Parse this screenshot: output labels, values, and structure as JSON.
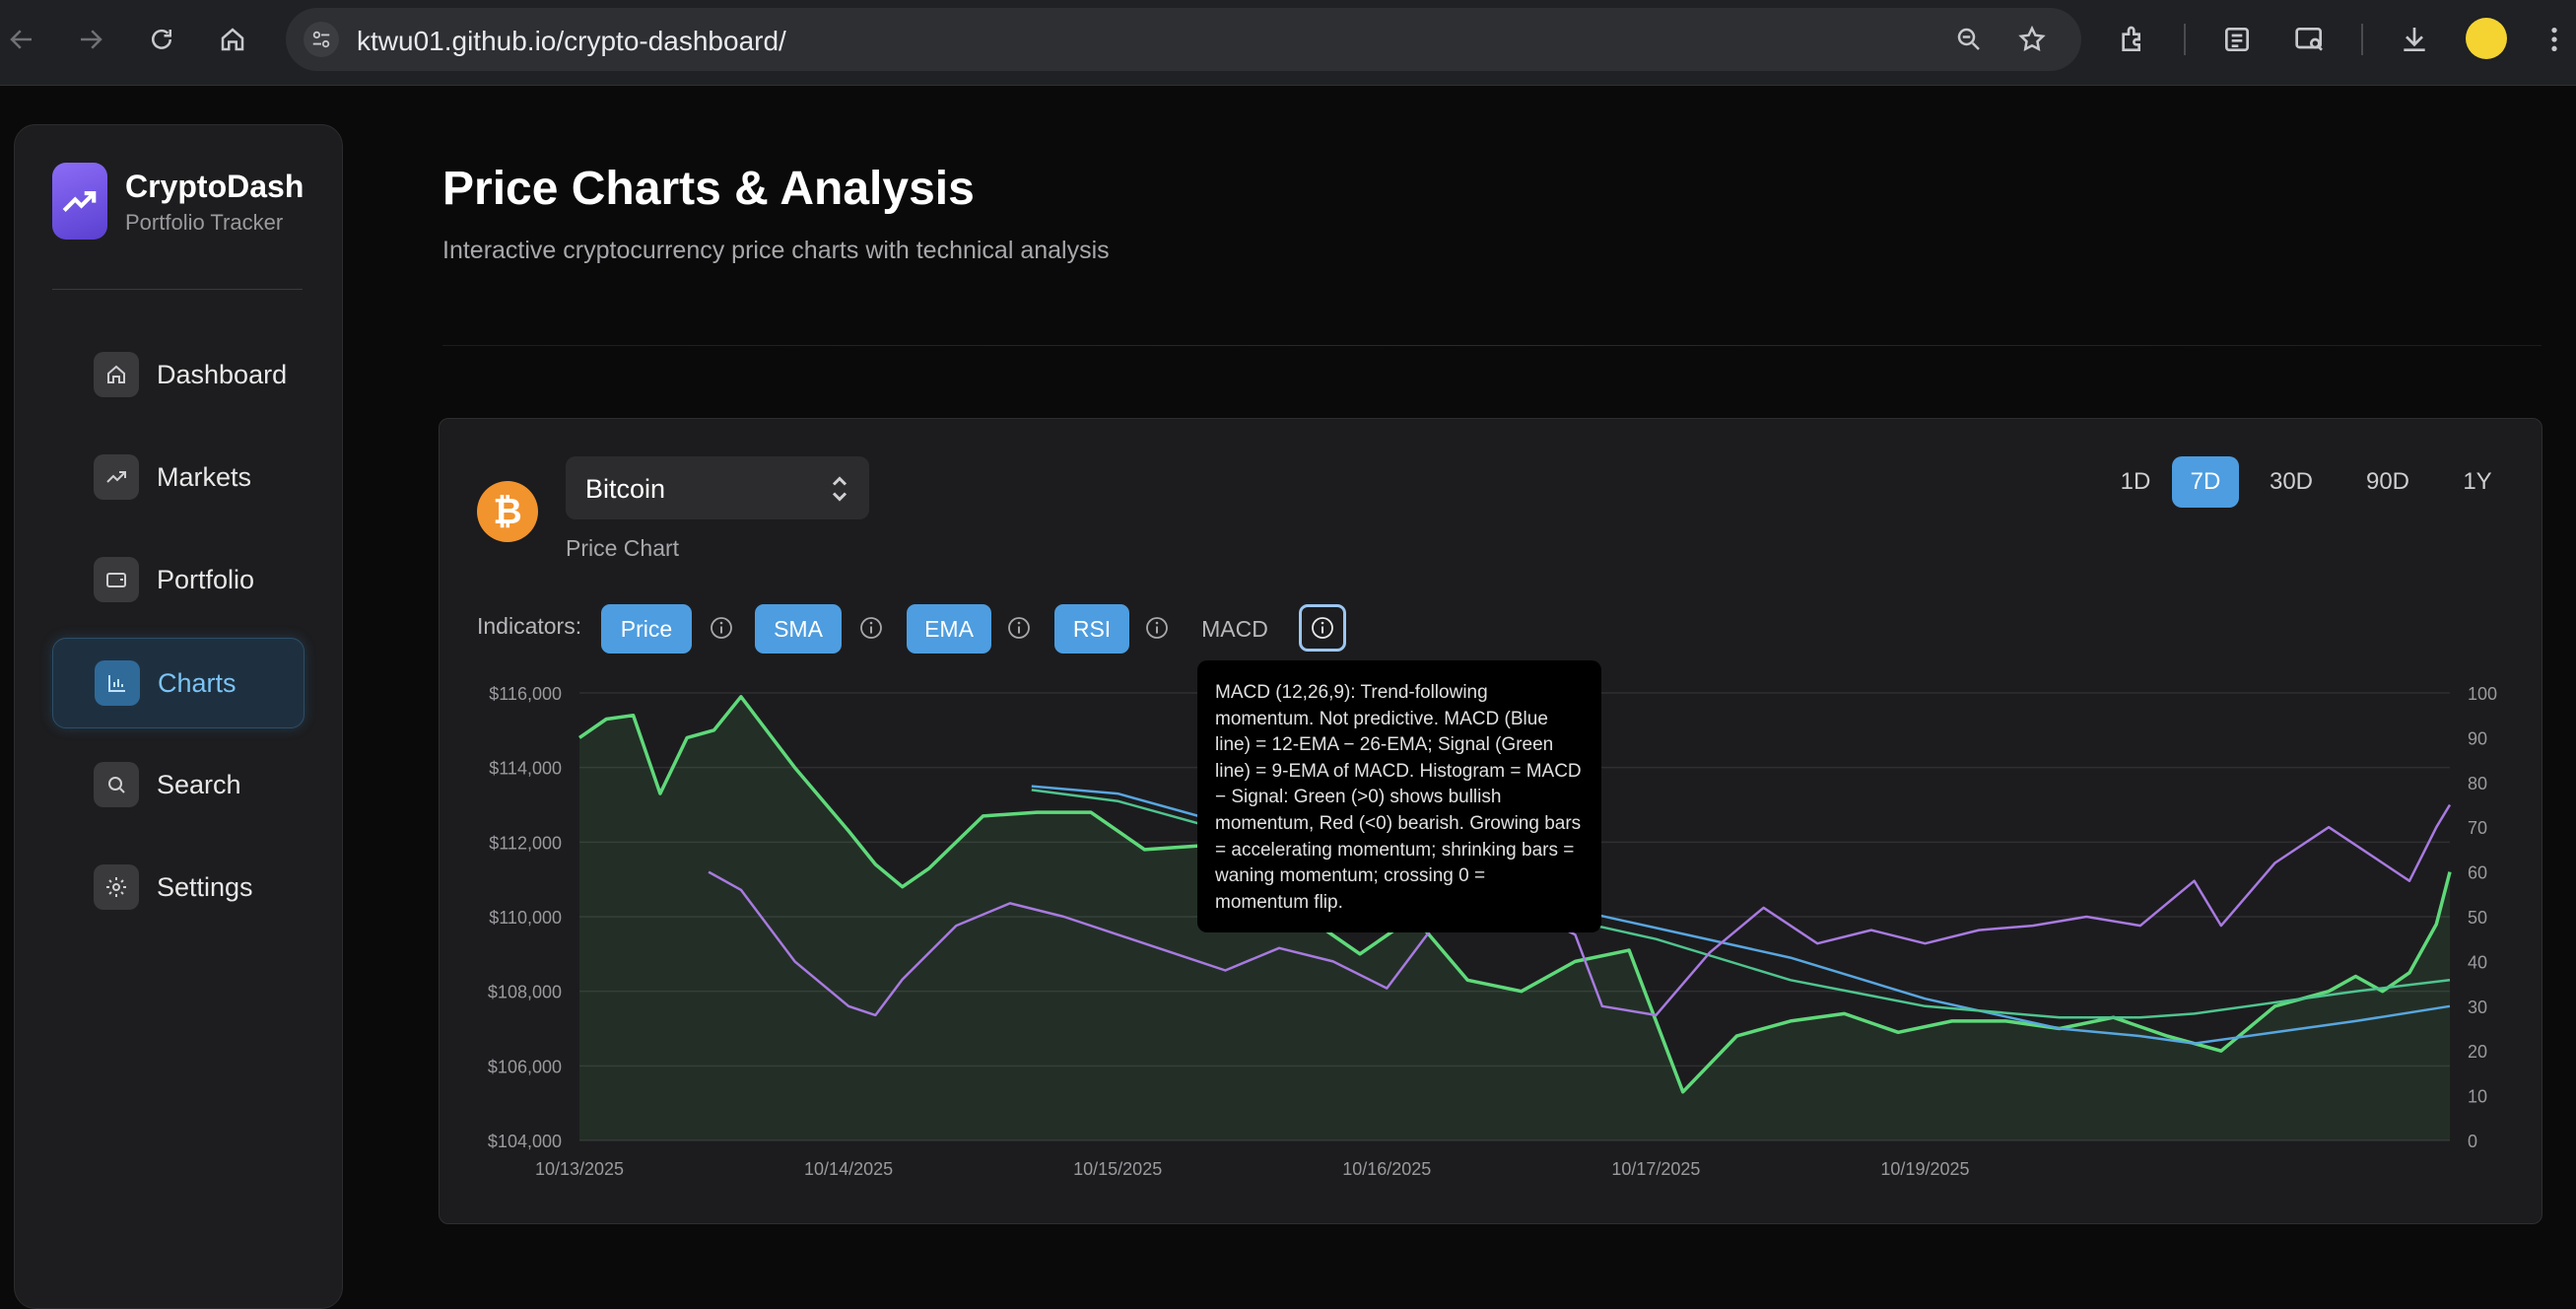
{
  "browser": {
    "url": "ktwu01.github.io/crypto-dashboard/"
  },
  "sidebar": {
    "brand": "CryptoDash",
    "brand_sub": "Portfolio Tracker",
    "items": [
      {
        "label": "Dashboard",
        "icon": "home-icon"
      },
      {
        "label": "Markets",
        "icon": "trending-icon"
      },
      {
        "label": "Portfolio",
        "icon": "wallet-icon"
      },
      {
        "label": "Charts",
        "icon": "bar-chart-icon",
        "active": true
      },
      {
        "label": "Search",
        "icon": "search-icon"
      },
      {
        "label": "Settings",
        "icon": "gear-icon"
      }
    ]
  },
  "main": {
    "title": "Price Charts & Analysis",
    "subtitle": "Interactive cryptocurrency price charts with technical analysis"
  },
  "chart_card": {
    "coin": "Bitcoin",
    "chart_label": "Price Chart",
    "ranges": [
      "1D",
      "7D",
      "30D",
      "90D",
      "1Y"
    ],
    "active_range": "7D",
    "indicators_label": "Indicators:",
    "indicators": [
      {
        "label": "Price",
        "active": true
      },
      {
        "label": "SMA",
        "active": true
      },
      {
        "label": "EMA",
        "active": true
      },
      {
        "label": "RSI",
        "active": true
      },
      {
        "label": "MACD",
        "active": false
      }
    ],
    "tooltip": "MACD (12,26,9): Trend-following momentum. Not predictive. MACD (Blue line) = 12-EMA − 26-EMA; Signal (Green line) = 9-EMA of MACD. Histogram = MACD − Signal: Green (>0) shows bullish momentum, Red (<0) bearish. Growing bars = accelerating momentum; shrinking bars = waning momentum; crossing 0 = momentum flip."
  },
  "colors": {
    "accent": "#4d9de0",
    "price": "#5fd97a",
    "sma": "#58a6e0",
    "ema": "#4fc48f",
    "rsi": "#a87ae0",
    "bitcoin": "#f2942e"
  },
  "chart_data": {
    "type": "line",
    "x_tick_labels": [
      "10/13/2025",
      "10/14/2025",
      "10/15/2025",
      "10/16/2025",
      "10/17/2025",
      "10/19/2025"
    ],
    "y_left_ticks": [
      "$116,000",
      "$114,000",
      "$112,000",
      "$110,000",
      "$108,000",
      "$106,000",
      "$104,000"
    ],
    "y_right_ticks": [
      "100",
      "90",
      "80",
      "70",
      "60",
      "50",
      "40",
      "30",
      "20",
      "10",
      "0"
    ],
    "ylim_left": [
      104000,
      116000
    ],
    "ylim_right": [
      0,
      100
    ],
    "grid": true,
    "x_domain": [
      0,
      6.95
    ],
    "series": [
      {
        "name": "Price",
        "axis": "left",
        "fill": true,
        "x": [
          0,
          0.1,
          0.2,
          0.3,
          0.4,
          0.5,
          0.6,
          0.8,
          1.0,
          1.1,
          1.2,
          1.3,
          1.5,
          1.7,
          1.9,
          2.1,
          2.3,
          2.5,
          2.7,
          2.9,
          3.1,
          3.3,
          3.5,
          3.7,
          3.9,
          4.1,
          4.3,
          4.5,
          4.7,
          4.9,
          5.1,
          5.3,
          5.5,
          5.7,
          5.9,
          6.1,
          6.3,
          6.5,
          6.6,
          6.7,
          6.8,
          6.9,
          6.95
        ],
        "y": [
          114800,
          115300,
          115400,
          113300,
          114800,
          115000,
          115900,
          114000,
          112300,
          111400,
          110800,
          111300,
          112700,
          112800,
          112800,
          111800,
          111900,
          110400,
          110000,
          109000,
          110000,
          108300,
          108000,
          108800,
          109100,
          105300,
          106800,
          107200,
          107400,
          106900,
          107200,
          107200,
          107000,
          107300,
          106800,
          106400,
          107600,
          108000,
          108400,
          108000,
          108500,
          109800,
          111200
        ]
      },
      {
        "name": "SMA",
        "axis": "left",
        "x": [
          1.68,
          2.0,
          2.5,
          3.0,
          3.5,
          4.0,
          4.5,
          5.0,
          5.5,
          5.8,
          6.0,
          6.3,
          6.6,
          6.95
        ],
        "y": [
          113500,
          113300,
          112300,
          111300,
          110500,
          109700,
          108900,
          107800,
          107000,
          106800,
          106600,
          106900,
          107200,
          107600
        ]
      },
      {
        "name": "EMA",
        "axis": "left",
        "x": [
          1.68,
          2.0,
          2.5,
          3.0,
          3.5,
          4.0,
          4.5,
          5.0,
          5.5,
          5.8,
          6.0,
          6.3,
          6.6,
          6.95
        ],
        "y": [
          113400,
          113100,
          112100,
          111000,
          110200,
          109400,
          108300,
          107600,
          107300,
          107300,
          107400,
          107700,
          108000,
          108300
        ]
      },
      {
        "name": "RSI",
        "axis": "right",
        "x": [
          0.48,
          0.6,
          0.8,
          1.0,
          1.1,
          1.2,
          1.4,
          1.6,
          1.8,
          2.0,
          2.2,
          2.4,
          2.6,
          2.8,
          3.0,
          3.2,
          3.3,
          3.5,
          3.7,
          3.8,
          4.0,
          4.2,
          4.4,
          4.6,
          4.8,
          5.0,
          5.2,
          5.4,
          5.6,
          5.8,
          6.0,
          6.1,
          6.3,
          6.5,
          6.7,
          6.8,
          6.9,
          6.95
        ],
        "y": [
          60,
          56,
          40,
          30,
          28,
          36,
          48,
          53,
          50,
          46,
          42,
          38,
          43,
          40,
          34,
          50,
          48,
          52,
          46,
          30,
          28,
          42,
          52,
          44,
          47,
          44,
          47,
          48,
          50,
          48,
          58,
          48,
          62,
          70,
          62,
          58,
          70,
          75
        ]
      }
    ]
  }
}
